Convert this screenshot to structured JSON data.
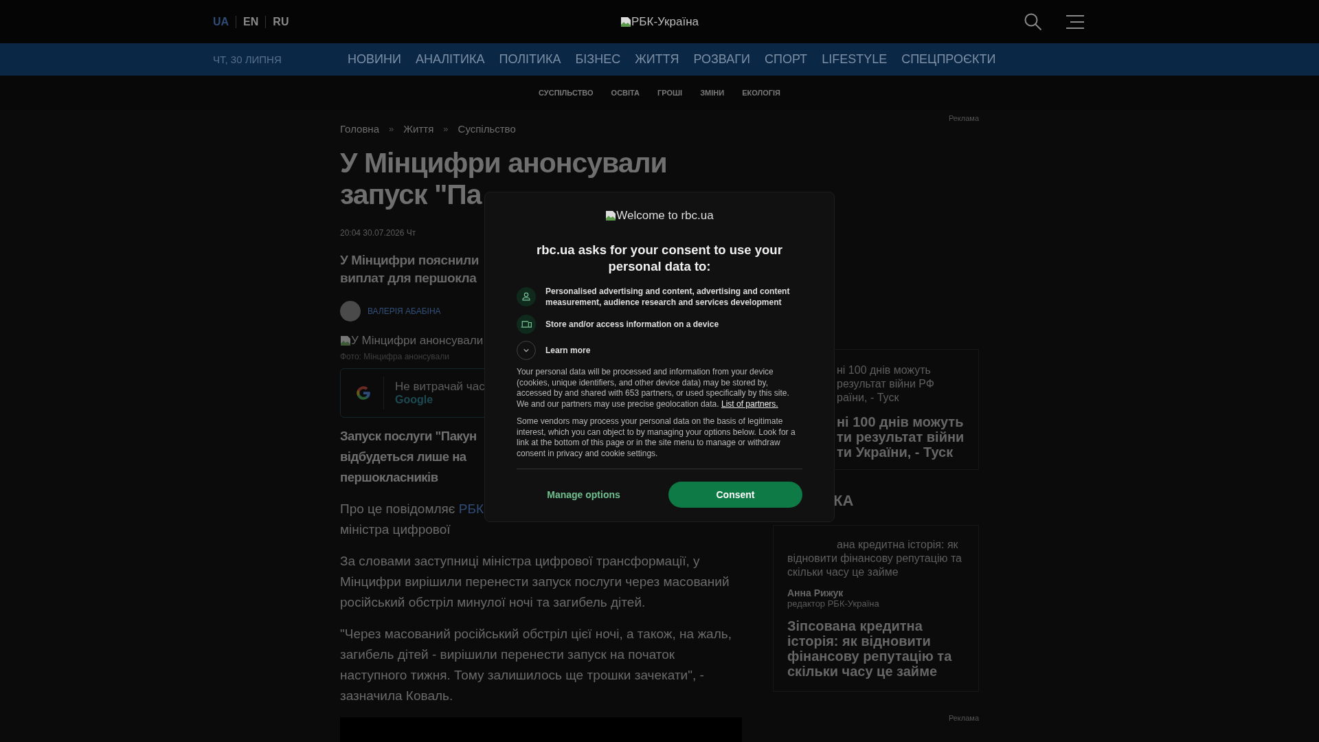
{
  "header": {
    "languages": [
      {
        "label": "UA",
        "selected": true
      },
      {
        "label": "EN",
        "selected": false
      },
      {
        "label": "RU",
        "selected": false
      }
    ],
    "logo_alt": "РБК-Україна"
  },
  "nav": {
    "date": "ЧТ, 30 ЛИПНЯ",
    "items": [
      "НОВИНИ",
      "АНАЛІТИКА",
      "ПОЛІТИКА",
      "БІЗНЕС",
      "ЖИТТЯ",
      "РОЗВАГИ",
      "СПОРТ",
      "LIFESTYLE",
      "СПЕЦПРОЄКТИ"
    ]
  },
  "subnav": [
    "СУСПІЛЬСТВО",
    "ОСВІТА",
    "ГРОШІ",
    "ЗМІНИ",
    "ЕКОЛОГІЯ"
  ],
  "article": {
    "breadcrumbs": [
      {
        "kind": "link",
        "label": "Головна"
      },
      {
        "kind": "separator",
        "label": "»"
      },
      {
        "kind": "link",
        "label": "Життя"
      },
      {
        "kind": "separator",
        "label": "»"
      },
      {
        "kind": "link",
        "label": "Суспільство"
      }
    ],
    "title_lines": [
      "У Мінцифри анонсували",
      "запуск \"Па"
    ],
    "date": "20:04 30.07.2026 Чт",
    "lead_lines": [
      "У Мінцифри пояснили",
      "виплат для першокла"
    ],
    "author": "ВАЛЕРІЯ АБАБІНА",
    "image_alt": "У Мінцифри анонсували",
    "caption": "Фото: Мінцифра анонсували",
    "google_card": {
      "text": "Не витрачай час",
      "brand": "Google"
    },
    "paragraphs": [
      {
        "kind": "partial_bold",
        "lines": [
          "Запуск послуги \"Пакун",
          "відбудеться лише на",
          "першокласників"
        ]
      },
      {
        "kind": "source",
        "lead": "Про це повідомляє ",
        "link": "РБК",
        "lines": [
          "міністра цифрової"
        ]
      },
      {
        "kind": "plain",
        "text": "За словами заступниці міністра цифрової трансформації, у Мінцифри вирішили перенести запуск послуги через масований російський обстріл минулої ночі та загибель дітей."
      },
      {
        "kind": "plain",
        "text": "\"Через масований російський обстріл цієї ночі, а також, на жаль, загибель дітей - вирішили перенести запуск на початок наступного тижня. Тому залишилось ще трошки зачекати\", - зазначила Коваль."
      }
    ]
  },
  "sidebar": {
    "ad_label_top": "Реклама",
    "news_card": {
      "small_lines": [
        "ні 100 днів можуть",
        "результат війни РФ",
        "раїни, - Туск"
      ],
      "title_lines": [
        "ні 100 днів можуть",
        "ти результат війни",
        "ти України, - Туск"
      ]
    },
    "section_title": "КА",
    "opinion_card": {
      "lead_lines": [
        "ана кредитна історія: як",
        "відновити фінансову репутацію та",
        "скільки часу це займе"
      ],
      "author": "Анна Рижук",
      "role": "редактор РБК-Україна",
      "title": "Зіпсована кредитна історія: як відновити фінансову репутацію та скільки часу це займе"
    },
    "ad_label_bottom": "Реклама"
  },
  "consent": {
    "logo_alt": "Welcome to rbc.ua",
    "heading": "rbc.ua asks for your consent to use your personal data to:",
    "purposes": [
      {
        "kind": "person",
        "text": "Personalised advertising and content, advertising and content measurement, audience research and services development"
      },
      {
        "kind": "device",
        "text": "Store and/or access information on a device"
      }
    ],
    "learn_more": {
      "label": "Learn more",
      "expanded": false
    },
    "paragraphs": [
      {
        "text": "Your personal data will be processed and information from your device (cookies, unique identifiers, and other device data) may be stored by, accessed by and shared with 653 partners, or used specifically by this site. We and our partners may use precise geolocation data. ",
        "link": "List of partners."
      },
      {
        "text": "Some vendors may process your personal data on the basis of legitimate interest, which you can object to by managing your options below. Look for a link at the bottom of this page or in the site menu to manage or withdraw consent in privacy and cookie settings."
      }
    ],
    "manage_button": "Manage options",
    "consent_button": "Consent"
  }
}
